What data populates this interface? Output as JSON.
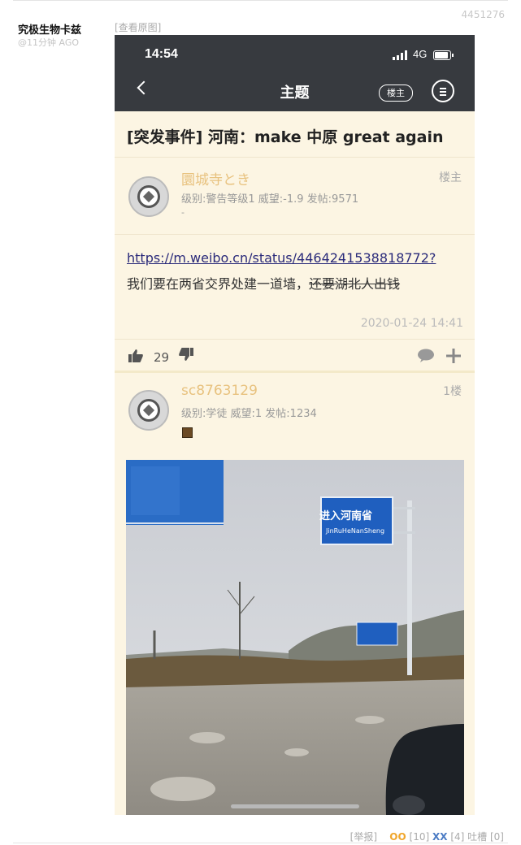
{
  "post": {
    "id": "4451276",
    "author": "究极生物卡兹",
    "time": "@11分钟 AGO",
    "view_original": "[查看原图]"
  },
  "screenshot": {
    "status_bar": {
      "time": "14:54",
      "network": "4G"
    },
    "nav": {
      "title": "主题",
      "owner_button": "楼主"
    },
    "thread_title": "[突发事件] 河南：make 中原 great again",
    "first_post": {
      "username": "圜城寺とき",
      "floor": "楼主",
      "meta": "级别:警告等级1  威望:-1.9  发帖:9571",
      "dot": "-",
      "link": "https://m.weibo.cn/status/4464241538818772?",
      "text_plain": "我们要在两省交界处建一道墙，",
      "text_strike": "还要湖北人出钱",
      "date": "2020-01-24 14:41",
      "likes": "29"
    },
    "reply": {
      "username": "sc8763129",
      "floor": "1楼",
      "meta": "级别:学徒  威望:1  发帖:1234",
      "photo": {
        "sign_main": "进入河南省",
        "sign_sub": "JinRuHeNanSheng"
      }
    }
  },
  "actions": {
    "report": "[举报]",
    "oo_label": "OO",
    "oo_count": "[10]",
    "xx_label": "XX",
    "xx_count": "[4]",
    "tucao": "吐槽 [0]"
  },
  "colors": {
    "navbar": "#373a3f",
    "post_bg": "#fcf5e3",
    "username": "#e8c27f",
    "oo": "#f0a62c",
    "xx": "#4a7bc4"
  }
}
